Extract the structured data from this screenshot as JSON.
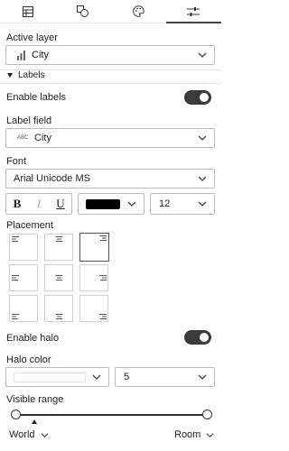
{
  "tabs": [
    {
      "icon": "table-icon",
      "active": false
    },
    {
      "icon": "shapes-icon",
      "active": false
    },
    {
      "icon": "palette-icon",
      "active": false
    },
    {
      "icon": "sliders-icon",
      "active": true
    }
  ],
  "active_layer": {
    "label": "Active layer",
    "value": "City",
    "icon": "bar-chart-icon"
  },
  "labels_section": {
    "title": "Labels",
    "expanded": true
  },
  "enable_labels": {
    "label": "Enable labels",
    "on": true
  },
  "label_field": {
    "label": "Label field",
    "type_badge": "ABC",
    "value": "City"
  },
  "font": {
    "label": "Font",
    "value": "Arial Unicode MS"
  },
  "text_style": {
    "bold": "B",
    "italic": "I",
    "underline": "U",
    "color": "#000000",
    "size": "12"
  },
  "placement": {
    "label": "Placement",
    "selected": "top-right"
  },
  "enable_halo": {
    "label": "Enable halo",
    "on": true
  },
  "halo_color": {
    "label": "Halo color",
    "color": "#ffffff",
    "size": "5"
  },
  "visible_range": {
    "label": "Visible range",
    "min_label": "World",
    "max_label": "Room"
  },
  "colors": {
    "accent": "#3b3b3b",
    "border": "#bdbdbd"
  }
}
